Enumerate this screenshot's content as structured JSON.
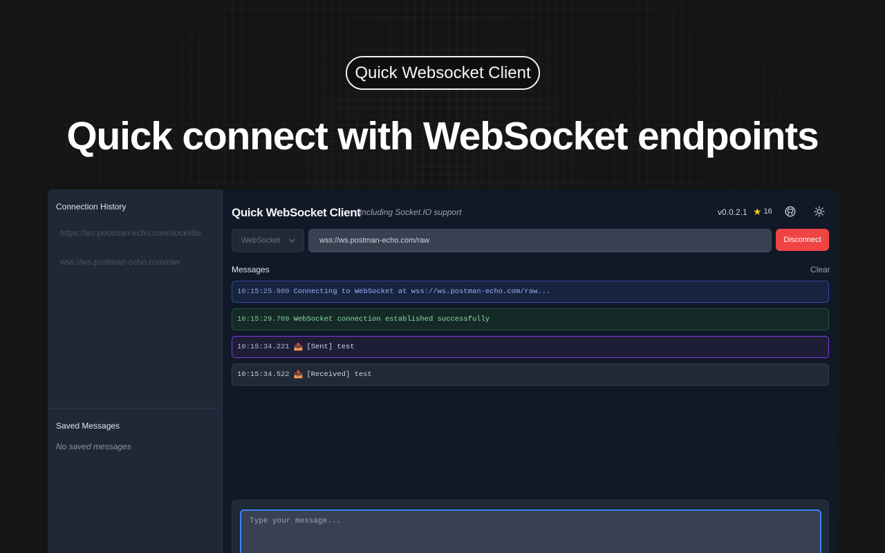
{
  "hero": {
    "badge": "Quick Websocket Client",
    "headline": "Quick connect with WebSocket endpoints"
  },
  "sidebar": {
    "history_title": "Connection History",
    "history": [
      {
        "url": "https://ws.postman-echo.com/socketio"
      },
      {
        "url": "wss://ws.postman-echo.com/raw"
      }
    ],
    "saved_title": "Saved Messages",
    "saved_empty": "No saved messages"
  },
  "header": {
    "title": "Quick WebSocket Client",
    "subtitle": "Including Socket.IO support",
    "version": "v0.0.2.1",
    "stars": "16",
    "icons": [
      "star-icon",
      "github-icon",
      "sun-icon"
    ]
  },
  "connection": {
    "protocol": "WebSocket",
    "url": "wss://ws.postman-echo.com/raw",
    "disconnect_label": "Disconnect"
  },
  "messages": {
    "label": "Messages",
    "clear_label": "Clear",
    "items": [
      {
        "time": "10:15:25.980",
        "text": "Connecting to WebSocket at wss://ws.postman-echo.com/raw...",
        "kind": "info"
      },
      {
        "time": "10:15:29.709",
        "text": "WebSocket connection established successfully",
        "kind": "success"
      },
      {
        "time": "10:15:34.221",
        "text": "[Sent] test",
        "kind": "sent"
      },
      {
        "time": "10:15:34.522",
        "text": "[Received] test",
        "kind": "received"
      }
    ]
  },
  "composer": {
    "placeholder": "Type your message..."
  },
  "colors": {
    "accent": "#3b82f6",
    "danger": "#ef4444",
    "star": "#facc15",
    "sent_border": "#7c3aed",
    "success_text": "#86e0a8"
  }
}
